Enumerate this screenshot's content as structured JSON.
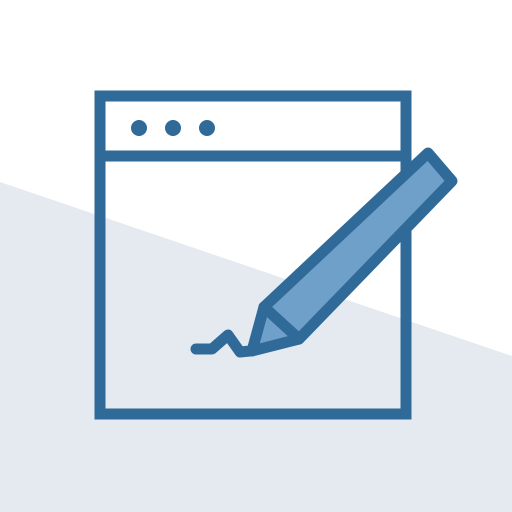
{
  "illustration": {
    "icon": "browser-window-with-pencil-edit-icon",
    "elements": {
      "window": "browser-window-icon",
      "window_dots": "three-dots-icon",
      "pencil": "pencil-icon",
      "scribble": "signature-scribble"
    }
  },
  "colors": {
    "page_background": "#ffffff",
    "background_shape": "#e4eaf0",
    "stroke": "#2f6a99",
    "pencil_fill": "#6fa0ca",
    "window_fill": "#ffffff"
  }
}
